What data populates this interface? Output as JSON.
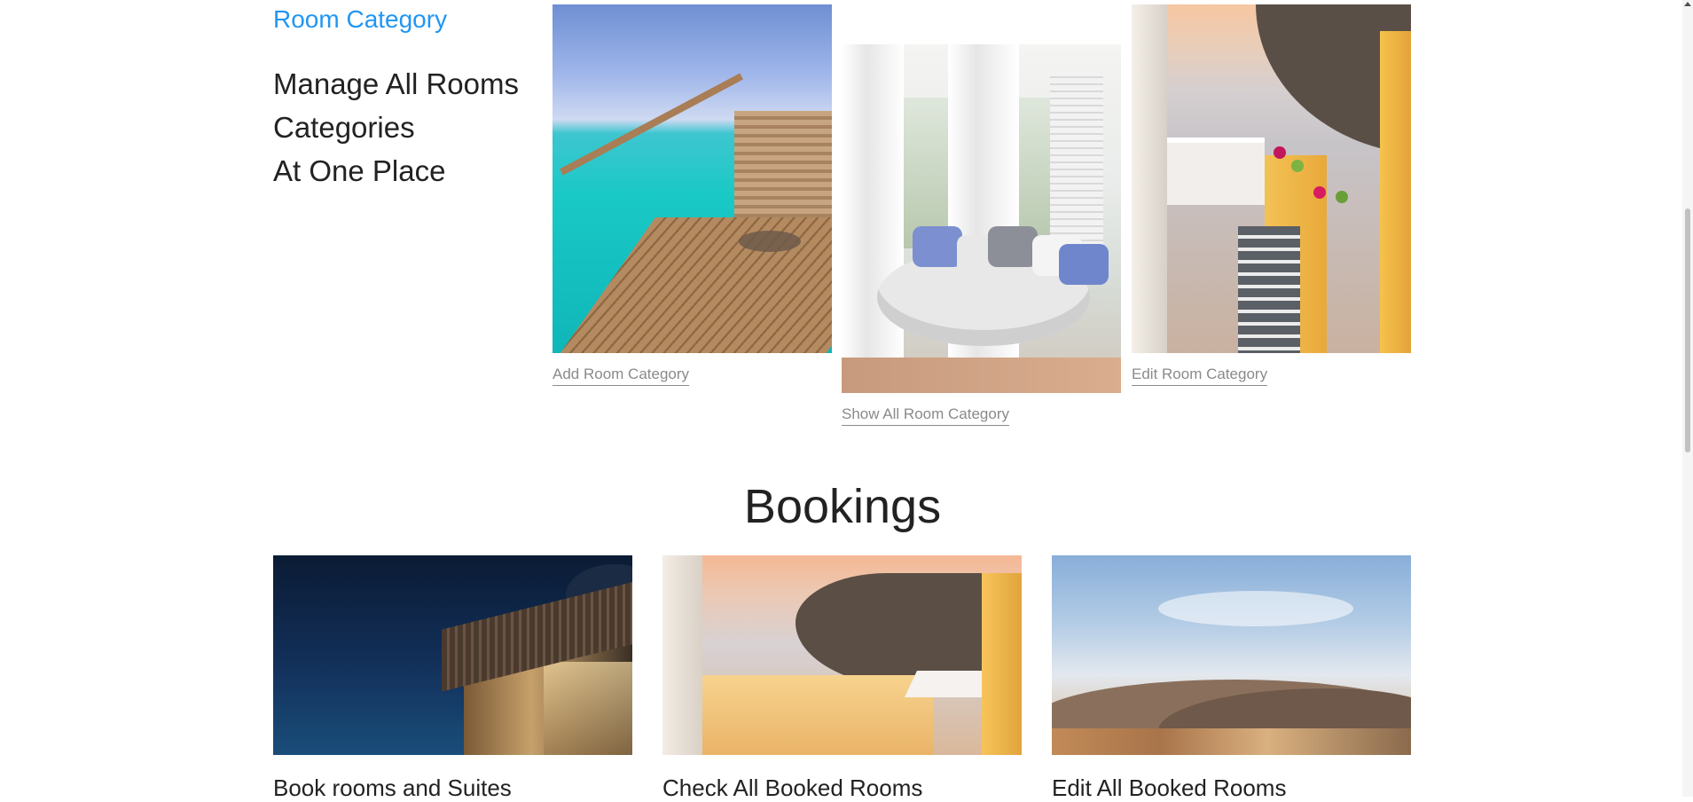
{
  "room_category": {
    "kicker": "Room Category",
    "lead": [
      "Manage All Rooms",
      "Categories",
      "At One Place"
    ],
    "tiles": [
      {
        "caption": "Add Room Category",
        "image": "deck-sea-photo"
      },
      {
        "caption": "Show All Room Category",
        "image": "daybed-photo"
      },
      {
        "caption": "Edit Room Category",
        "image": "santorini-stairs-photo"
      }
    ]
  },
  "bookings": {
    "title": "Bookings",
    "cards": [
      {
        "title": "Book rooms and Suites",
        "image": "night-villa-photo"
      },
      {
        "title": "Check All Booked Rooms",
        "image": "santorini-terrace-photo"
      },
      {
        "title": "Edit All Booked Rooms",
        "image": "hills-landscape-photo"
      }
    ]
  },
  "colors": {
    "accent": "#2196f3",
    "caption": "#8a8a8a",
    "text": "#222222"
  }
}
